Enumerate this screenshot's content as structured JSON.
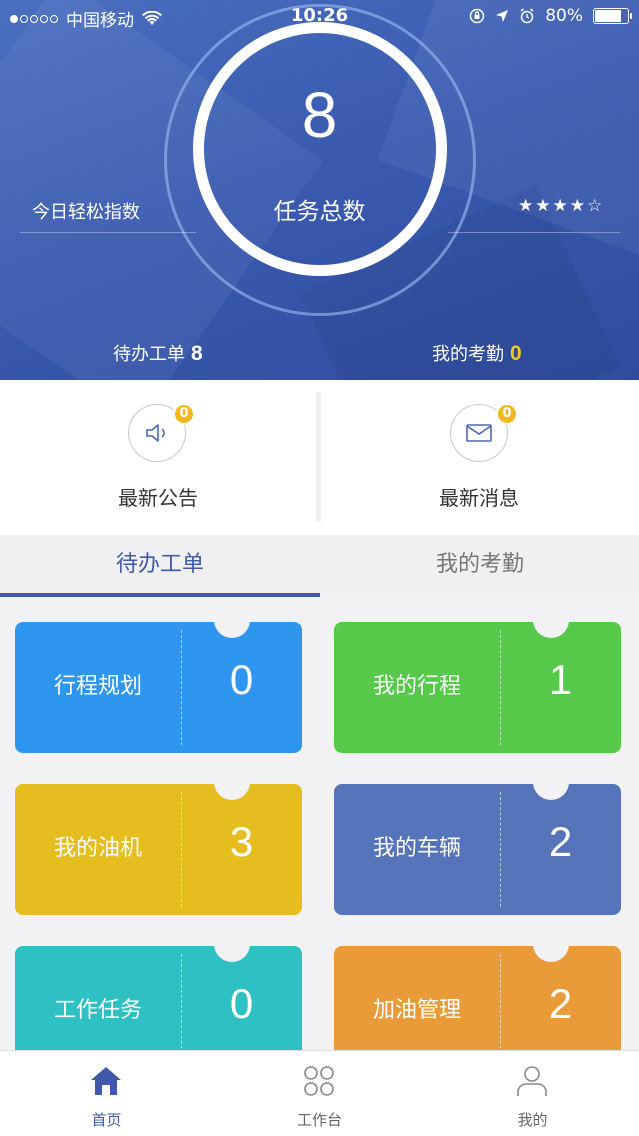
{
  "status_bar": {
    "carrier": "中国移动",
    "time": "10:26",
    "battery": "80%",
    "battery_level": 0.8
  },
  "header": {
    "task_count": "8",
    "task_label": "任务总数",
    "ease_label": "今日轻松指数",
    "ease_rating": 4.5,
    "stars": "★★★★☆",
    "pending_label": "待办工单",
    "pending_count": "8",
    "attendance_label": "我的考勤",
    "attendance_count": "0"
  },
  "notice": {
    "announcement": {
      "label": "最新公告",
      "badge": "0",
      "icon": "speaker-icon"
    },
    "message": {
      "label": "最新消息",
      "badge": "0",
      "icon": "envelope-icon"
    }
  },
  "tabs": [
    {
      "label": "待办工单",
      "active": true
    },
    {
      "label": "我的考勤",
      "active": false
    }
  ],
  "cards": [
    {
      "label": "行程规划",
      "count": "0",
      "color": "#2f96f0"
    },
    {
      "label": "我的行程",
      "count": "1",
      "color": "#56c94a"
    },
    {
      "label": "我的油机",
      "count": "3",
      "color": "#e6bd1f"
    },
    {
      "label": "我的车辆",
      "count": "2",
      "color": "#5674ba"
    },
    {
      "label": "工作任务",
      "count": "0",
      "color": "#2ec0c2"
    },
    {
      "label": "加油管理",
      "count": "2",
      "color": "#e99b39"
    }
  ],
  "bottom_nav": [
    {
      "label": "首页",
      "icon": "home-icon",
      "active": true
    },
    {
      "label": "工作台",
      "icon": "grid-icon",
      "active": false
    },
    {
      "label": "我的",
      "icon": "user-icon",
      "active": false
    }
  ],
  "colors": {
    "accent": "#3e5aa8",
    "badge": "#f3b721",
    "header": "#3a5ab0"
  }
}
